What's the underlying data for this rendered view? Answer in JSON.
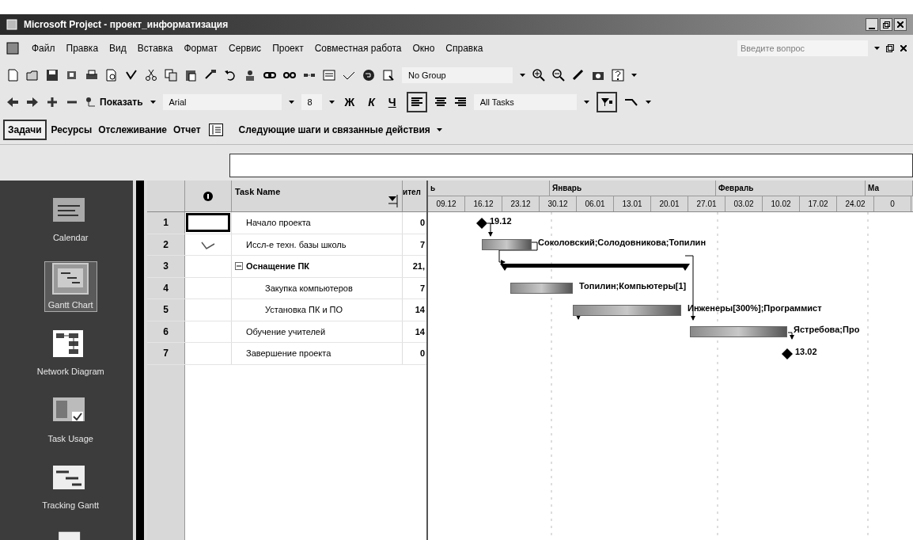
{
  "window": {
    "title": "Microsoft Project - проект_информатизация"
  },
  "menu": [
    "Файл",
    "Правка",
    "Вид",
    "Вставка",
    "Формат",
    "Сервис",
    "Проект",
    "Совместная работа",
    "Окно",
    "Справка"
  ],
  "help_search": {
    "placeholder": "Введите вопрос"
  },
  "toolbar": {
    "group": "No Group",
    "show": "Показать",
    "font": "Arial",
    "font_size": "8",
    "bold": "Ж",
    "italic": "К",
    "underline": "Ч",
    "filter": "All Tasks"
  },
  "guide": {
    "tabs": [
      {
        "label": "Задачи",
        "selected": true
      },
      {
        "label": "Ресурсы",
        "selected": false
      },
      {
        "label": "Отслеживание",
        "selected": false
      },
      {
        "label": "Отчет",
        "selected": false
      }
    ],
    "next_steps": "Следующие шаги и связанные действия"
  },
  "views": [
    {
      "label": "Calendar",
      "selected": false
    },
    {
      "label": "Gantt Chart",
      "selected": true
    },
    {
      "label": "Network Diagram",
      "selected": false
    },
    {
      "label": "Task Usage",
      "selected": false
    },
    {
      "label": "Tracking Gantt",
      "selected": false
    }
  ],
  "table": {
    "columns": [
      "Task Name",
      "ител"
    ],
    "rows": [
      {
        "id": "1",
        "name": "Начало проекта",
        "duration": "0",
        "kind": "milestone",
        "selected": true,
        "gantt_label": "19.12"
      },
      {
        "id": "2",
        "name": "Иссл-е техн. базы школь",
        "duration": "7",
        "kind": "task",
        "selected": false,
        "has_note": true,
        "gantt_label": "Соколовский;Солодовникова;Топилин"
      },
      {
        "id": "3",
        "name": "Оснащение ПК",
        "duration": "21,",
        "kind": "summary",
        "selected": false,
        "expanded": true,
        "children": [
          {
            "id": "4",
            "name": "Закупка компьютеров",
            "duration": "7",
            "kind": "task",
            "selected": false,
            "gantt_label": "Топилин;Компьютеры[1]"
          },
          {
            "id": "5",
            "name": "Установка ПК и ПО",
            "duration": "14",
            "kind": "task",
            "selected": false,
            "gantt_label": "Инженеры[300%];Программист"
          }
        ]
      },
      {
        "id": "6",
        "name": "Обучение учителей",
        "duration": "14",
        "kind": "task",
        "selected": false,
        "gantt_label": "Ястребова;Про"
      },
      {
        "id": "7",
        "name": "Завершение проекта",
        "duration": "0",
        "kind": "milestone",
        "selected": false,
        "gantt_label": "13.02"
      }
    ]
  },
  "timescale": {
    "months": [
      "ь",
      "Январь",
      "Февраль",
      "Ма"
    ],
    "weeks": [
      "09.12",
      "16.12",
      "23.12",
      "30.12",
      "06.01",
      "13.01",
      "20.01",
      "27.01",
      "03.02",
      "10.02",
      "17.02",
      "24.02",
      "0"
    ]
  }
}
